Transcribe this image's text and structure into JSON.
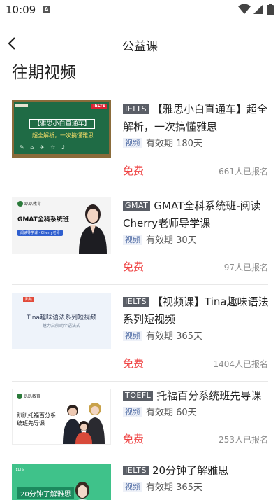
{
  "status_bar": {
    "time": "10:09",
    "notification_icon": "A"
  },
  "nav": {
    "title": "公益课"
  },
  "section_title": "往期视频",
  "courses": [
    {
      "tag": "IELTS",
      "title": "【雅思小白直通车】超全解析，一次搞懂雅思",
      "type_tag": "视频",
      "validity": "有效期 180天",
      "price": "免费",
      "enrolled": "661人已报名",
      "thumb": {
        "box_text": "【雅思小白直通车】",
        "sub_text": "超全解析，一次搞懂雅思",
        "badge": "IELTS"
      }
    },
    {
      "tag": "GMAT",
      "title": "GMAT全科系统班-阅读Cherry老师导学课",
      "type_tag": "视频",
      "validity": "有效期 30天",
      "price": "免费",
      "enrolled": "97人已报名",
      "thumb": {
        "headline": "GMAT全科系统班",
        "pill": "阅读导学课 · Cherry老师"
      }
    },
    {
      "tag": "IELTS",
      "title": "【视频课】Tina趣味语法系列短视频",
      "type_tag": "视频",
      "validity": "有效期 365天",
      "price": "免费",
      "enrolled": "1404人已报名",
      "thumb": {
        "headline": "Tina趣味语法系列短视频",
        "sub": "魅力启航助个语法式"
      }
    },
    {
      "tag": "TOEFL",
      "title": "托福百分系统班先导课",
      "type_tag": "视频",
      "validity": "有效期 60天",
      "price": "免费",
      "enrolled": "253人已报名",
      "thumb": {
        "headline": "趴趴托福百分系统班先导课"
      }
    },
    {
      "tag": "IELTS",
      "title": "20分钟了解雅思",
      "type_tag": "视频",
      "validity": "有效期 365天",
      "thumb": {
        "headline": "20分钟了解雅思",
        "logo": "IELTS"
      }
    }
  ],
  "colors": {
    "price": "#ef4343",
    "tag_bg": "#5a5e66",
    "video_tag_text": "#5671a8"
  }
}
